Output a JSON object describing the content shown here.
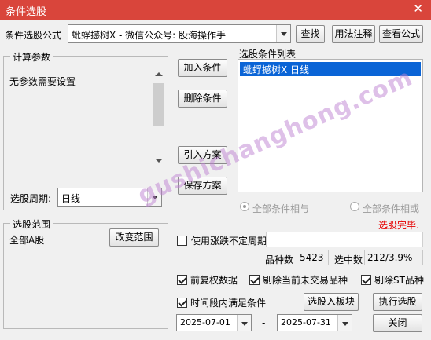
{
  "window": {
    "title": "条件选股",
    "close_glyph": "✕"
  },
  "formula": {
    "label": "条件选股公式",
    "value": "蚍蜉撼树X  -  微信公众号: 股海操作手",
    "buttons": {
      "search": "查找",
      "usage": "用法注释",
      "view": "查看公式"
    }
  },
  "params": {
    "title": "计算参数",
    "message": "无参数需要设置",
    "period_label": "选股周期:",
    "period_value": "日线"
  },
  "actions": {
    "add": "加入条件",
    "delete": "删除条件",
    "import": "引入方案",
    "save": "保存方案"
  },
  "condition_list": {
    "title": "选股条件列表",
    "items": [
      "蚍蜉撼树X  日线"
    ]
  },
  "logic": {
    "all_and": "全部条件相与",
    "all_or": "全部条件相或",
    "status": "选股完毕."
  },
  "range": {
    "title": "选股范围",
    "value": "全部A股",
    "change_button": "改变范围"
  },
  "stats": {
    "variable_period_label": "使用涨跌不定周期",
    "count_label": "品种数",
    "count_value": "5423",
    "selected_label": "选中数",
    "selected_value": "212/3.9%"
  },
  "options": {
    "pre_adjust": "前复权数据",
    "exclude_untraded": "剔除当前未交易品种",
    "exclude_st": "剔除ST品种",
    "time_range": "时间段内满足条件"
  },
  "dates": {
    "start": "2025-07-01",
    "separator": "-",
    "end": "2025-07-31"
  },
  "bottom_buttons": {
    "to_block": "选股入板块",
    "execute": "执行选股",
    "close": "关闭"
  },
  "watermark": "gushichanghong.com",
  "colors": {
    "titlebar": "#d9453b",
    "selection": "#0a64d6",
    "status": "#e60000"
  }
}
